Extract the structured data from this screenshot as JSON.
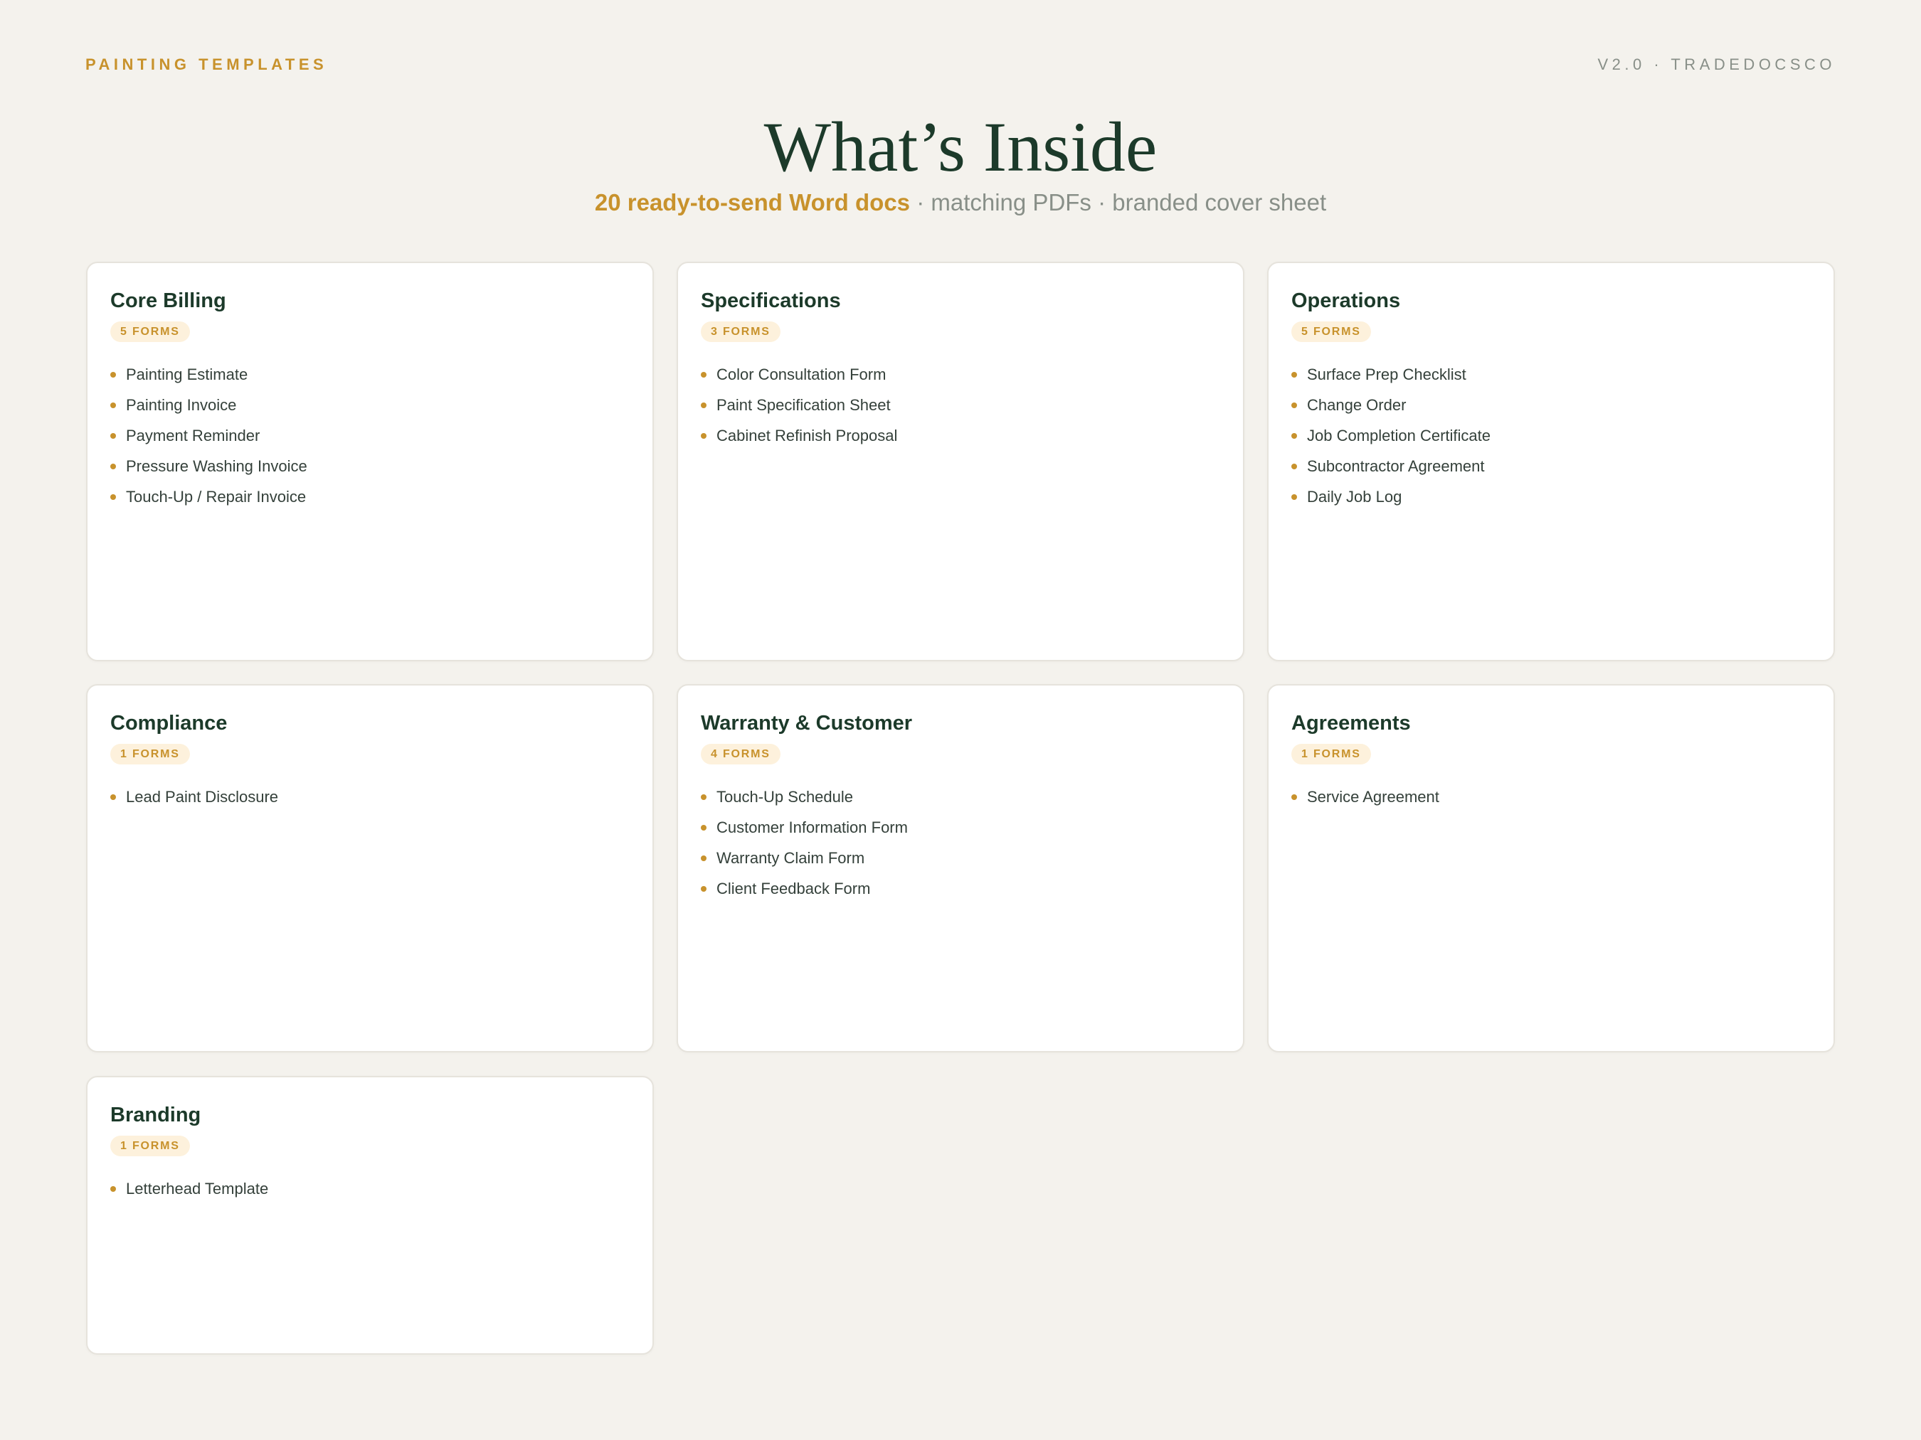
{
  "header": {
    "eyebrow": "PAINTING TEMPLATES",
    "version": "V2.0 · TRADEDOCSCO",
    "title": "What’s Inside",
    "subtitle_accent": "20 ready-to-send Word docs",
    "subtitle_rest": " · matching PDFs · branded cover sheet"
  },
  "colors": {
    "accent": "#c8922c",
    "heading": "#1c3a2a",
    "muted": "#888f88",
    "background": "#f4f2ed",
    "badge_bg": "#fdf1dc"
  },
  "icons": {
    "bullet": "dot-bullet-icon"
  },
  "cards": [
    {
      "title": "Core Billing",
      "badge": "5 FORMS",
      "items": [
        "Painting Estimate",
        "Painting Invoice",
        "Payment Reminder",
        "Pressure Washing Invoice",
        "Touch-Up / Repair Invoice"
      ]
    },
    {
      "title": "Specifications",
      "badge": "3 FORMS",
      "items": [
        "Color Consultation Form",
        "Paint Specification Sheet",
        "Cabinet Refinish Proposal"
      ]
    },
    {
      "title": "Operations",
      "badge": "5 FORMS",
      "items": [
        "Surface Prep Checklist",
        "Change Order",
        "Job Completion Certificate",
        "Subcontractor Agreement",
        "Daily Job Log"
      ]
    },
    {
      "title": "Compliance",
      "badge": "1 FORMS",
      "items": [
        "Lead Paint Disclosure"
      ]
    },
    {
      "title": "Warranty & Customer",
      "badge": "4 FORMS",
      "items": [
        "Touch-Up Schedule",
        "Customer Information Form",
        "Warranty Claim Form",
        "Client Feedback Form"
      ]
    },
    {
      "title": "Agreements",
      "badge": "1 FORMS",
      "items": [
        "Service Agreement"
      ]
    },
    {
      "title": "Branding",
      "badge": "1 FORMS",
      "items": [
        "Letterhead Template"
      ]
    }
  ]
}
